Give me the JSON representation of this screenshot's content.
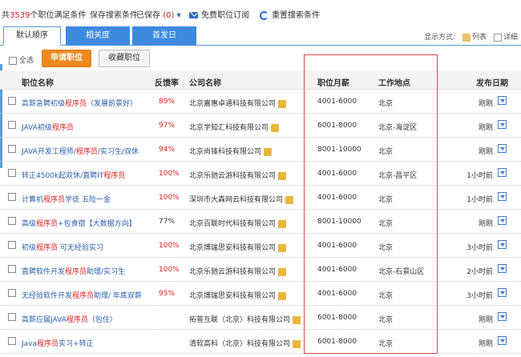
{
  "top": {
    "count_prefix": "共",
    "count": "3539",
    "count_suffix": "个职位满足条件",
    "save_search": "保存搜索条件",
    "saved": "已保存",
    "saved_count": "(0)",
    "subscribe": "免费职位订阅",
    "reset": "重置搜索条件"
  },
  "tabs": [
    "默认顺序",
    "相关度",
    "首发日"
  ],
  "display": {
    "label": "显示方式:",
    "list": "列表",
    "detail": "详细"
  },
  "actions": {
    "select_all": "全选",
    "apply": "申请职位",
    "favorite": "收藏职位"
  },
  "headers": {
    "job": "职位名称",
    "rate": "反馈率",
    "company": "公司名称",
    "salary": "职位月薪",
    "location": "工作地点",
    "date": "发布日期"
  },
  "rows": [
    {
      "pre": "高薪急聘初级",
      "kw": "程序员",
      "post": "（发展前景好）",
      "rate": "89%",
      "company": "北京嘉惠卓通科技有限公司",
      "badge": true,
      "salary": "4001-6000",
      "location": "北京",
      "date": "刚刚"
    },
    {
      "pre": "JAVA初级",
      "kw": "程序员",
      "post": "",
      "rate": "97%",
      "company": "北京学知汇科技有限公司",
      "badge": true,
      "salary": "6001-8000",
      "location": "北京-海淀区",
      "date": "刚刚"
    },
    {
      "pre": "JAVA开发工程师/",
      "kw": "程序员",
      "post": "/实习生/双休",
      "rate": "94%",
      "company": "北京尚锋科技有限公司",
      "badge": true,
      "salary": "8001-10000",
      "location": "北京",
      "date": "刚刚"
    },
    {
      "pre": "转正4500k起双休/直聘IT",
      "kw": "程序员",
      "post": "",
      "rate": "100%",
      "company": "北京乐驰云游科技有限公司",
      "badge": true,
      "salary": "4001-6000",
      "location": "北京-昌平区",
      "date": "1小时前"
    },
    {
      "pre": "计算机",
      "kw": "程序员",
      "post": "学徒 五险一金",
      "rate": "100%",
      "company": "深圳市大森网云科技有限公司",
      "badge": true,
      "salary": "4001-6000",
      "location": "北京",
      "date": "1小时前"
    },
    {
      "pre": "高级",
      "kw": "程序员",
      "post": "+包食宿【大数据方向】",
      "rate": "77%",
      "company": "北京百联时代科技有限公司",
      "badge": true,
      "salary": "8001-10000",
      "location": "北京",
      "date": "刚刚"
    },
    {
      "pre": "初级",
      "kw": "程序员",
      "post": " 可无经验实习",
      "rate": "100%",
      "company": "北京博瑞思安科技有限公司",
      "badge": true,
      "salary": "4001-6000",
      "location": "北京",
      "date": "3小时前"
    },
    {
      "pre": "直聘软件开发",
      "kw": "程序员",
      "post": "助理/实习生",
      "rate": "100%",
      "company": "北京乐驰云游科技有限公司",
      "badge": true,
      "salary": "4001-6000",
      "location": "北京-石景山区",
      "date": "2小时前"
    },
    {
      "pre": "无经验软件开发",
      "kw": "程序员",
      "post": "助理/ 年底双薪",
      "rate": "95%",
      "company": "北京博瑞思安科技有限公司",
      "badge": true,
      "salary": "4001-6000",
      "location": "北京",
      "date": "3小时前"
    },
    {
      "pre": "高薪应届JAVA",
      "kw": "程序员",
      "post": "（包住）",
      "rate": "",
      "company": "拓普互联（北京）科技有限公司",
      "badge": true,
      "salary": "6001-8000",
      "location": "北京",
      "date": "刚刚"
    },
    {
      "pre": "Java",
      "kw": "程序员",
      "post": "实习+转正",
      "rate": "",
      "company": "清软高科（北京）科技有限公司",
      "badge": true,
      "salary": "6001-8000",
      "location": "北京",
      "date": "刚刚"
    }
  ]
}
